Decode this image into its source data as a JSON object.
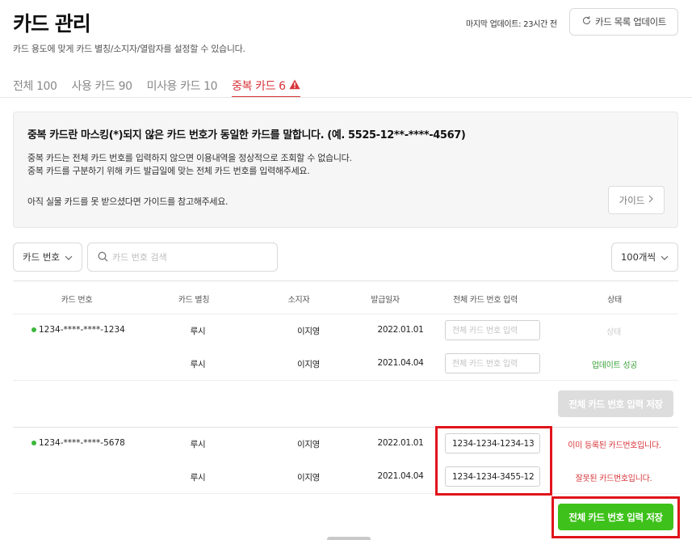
{
  "header": {
    "title": "카드 관리",
    "subtitle": "카드 용도에 맞게 카드 별칭/소지자/열람자를 설정할 수 있습니다.",
    "last_update": "마지막 업데이트: 23시간 전",
    "refresh_label": "카드 목록 업데이트"
  },
  "tabs": [
    {
      "label": "전체 100"
    },
    {
      "label": "사용 카드 90"
    },
    {
      "label": "미사용 카드 10"
    },
    {
      "label": "중복 카드 6",
      "active": true
    }
  ],
  "notice": {
    "title": "중복 카드란 마스킹(*)되지 않은 카드 번호가 동일한 카드를 말합니다. (예. 5525-12**-****-4567)",
    "line1": "중복 카드는 전체 카드 번호를 입력하지 않으면 이용내역을 정상적으로 조회할 수 없습니다.",
    "line2": "중복 카드를 구분하기 위해 카드 발급일에 맞는 전체 카드 번호를 입력해주세요.",
    "line3": "아직 실물 카드를 못 받으셨다면 가이드를 참고해주세요.",
    "guide_label": "가이드"
  },
  "filters": {
    "select_label": "카드 번호",
    "search_placeholder": "카드 번호 검색",
    "page_size": "100개씩"
  },
  "table": {
    "headers": [
      "카드 번호",
      "카드 별칭",
      "소지자",
      "발급일자",
      "전체 카드 번호 입력",
      "상태"
    ],
    "input_placeholder": "전체 카드 번호 입력",
    "groups": [
      {
        "card_number": "1234-****-****-1234",
        "rows": [
          {
            "alias": "루시",
            "holder": "이지영",
            "issued": "2022.01.01",
            "full_number": "",
            "status": "상태",
            "status_kind": "muted"
          },
          {
            "alias": "루시",
            "holder": "이지영",
            "issued": "2021.04.04",
            "full_number": "",
            "status": "업데이트 성공",
            "status_kind": "ok"
          }
        ],
        "save_label": "전체 카드 번호 입력 저장",
        "save_enabled": false
      },
      {
        "card_number": "1234-****-****-5678",
        "rows": [
          {
            "alias": "루시",
            "holder": "이지영",
            "issued": "2022.01.01",
            "full_number": "1234-1234-1234-13",
            "status": "이미 등록된 카드번호입니다.",
            "status_kind": "err"
          },
          {
            "alias": "루시",
            "holder": "이지영",
            "issued": "2021.04.04",
            "full_number": "1234-1234-3455-12",
            "status": "잘못된 카드번호입니다.",
            "status_kind": "err"
          }
        ],
        "save_label": "전체 카드 번호 입력 저장",
        "save_enabled": true
      }
    ]
  },
  "colors": {
    "accent_red": "#d9343a",
    "success_green": "#3ec21b",
    "highlight_red": "#e0141b"
  }
}
